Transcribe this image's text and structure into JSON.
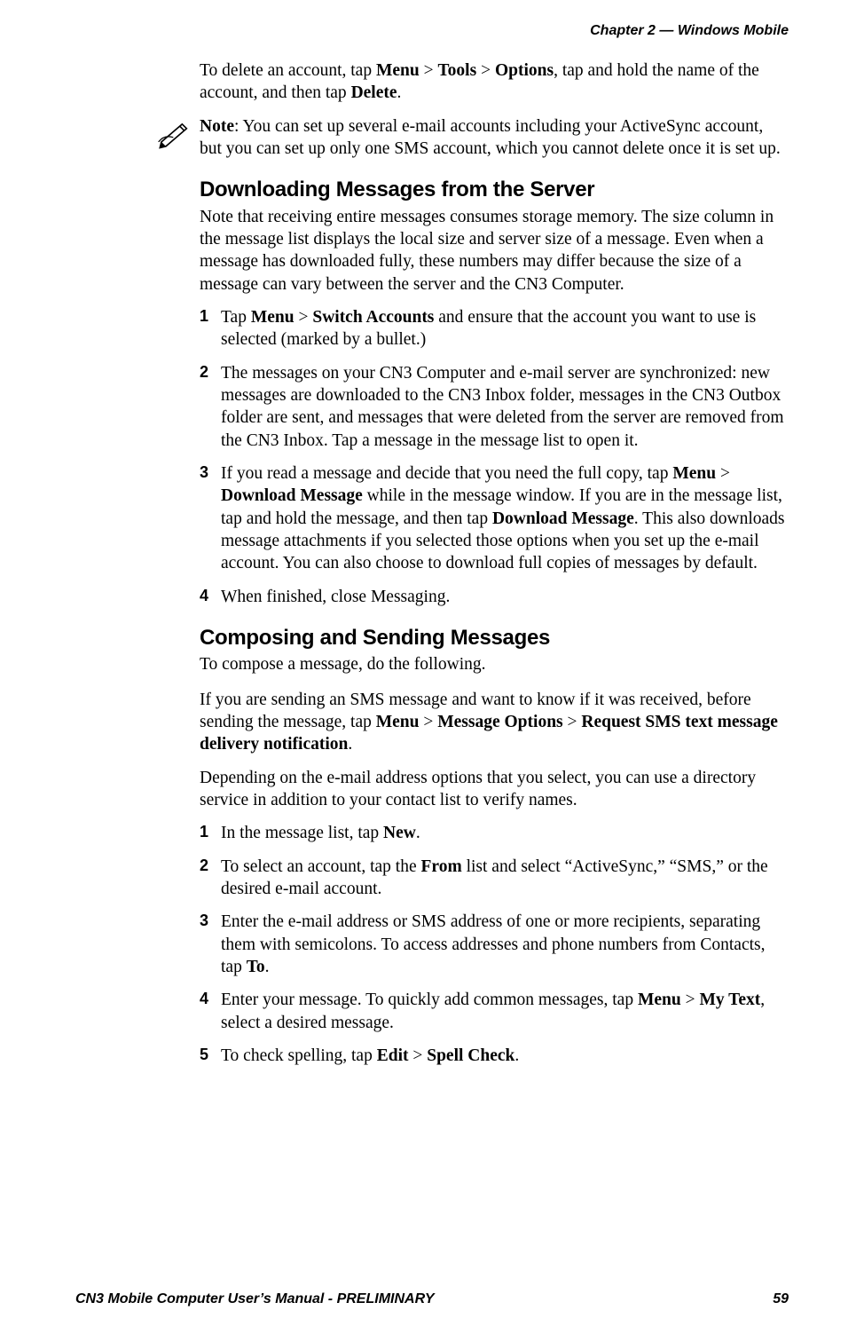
{
  "header": {
    "chapter_label": "Chapter 2 —  Windows Mobile"
  },
  "intro_para": {
    "pre": "To delete an account, tap ",
    "b1": "Menu",
    "sep1": " > ",
    "b2": "Tools",
    "sep2": " > ",
    "b3": "Options",
    "mid": ", tap and hold the name of the account, and then tap ",
    "b4": "Delete",
    "post": "."
  },
  "note": {
    "label": "Note",
    "text": ": You can set up several e-mail accounts including your ActiveSync account, but you can set up only one SMS account, which you cannot delete once it is set up."
  },
  "section1": {
    "heading": "Downloading Messages from the Server",
    "intro": "Note that receiving entire messages consumes storage memory. The size column in the message list displays the local size and server size of a message. Even when a message has downloaded fully, these numbers may differ because the size of a message can vary between the server and the CN3 Computer.",
    "step1": {
      "num": "1",
      "pre": "Tap ",
      "b1": "Menu",
      "sep1": " > ",
      "b2": "Switch Accounts",
      "post": " and ensure that the account you want to use is selected (marked by a bullet.)"
    },
    "step2": {
      "num": "2",
      "text": "The messages on your CN3 Computer and e-mail server are synchronized: new messages are downloaded to the CN3 Inbox folder, messages in the CN3 Outbox folder are sent, and messages that were deleted from the server are removed from the CN3 Inbox. Tap a message in the message list to open it."
    },
    "step3": {
      "num": "3",
      "pre": "If you read a message and decide that you need the full copy, tap ",
      "b1": "Menu",
      "sep1": " > ",
      "b2": "Download Message",
      "mid": " while in the message window. If you are in the message list, tap and hold the message, and then tap ",
      "b3": "Download Message",
      "post": ". This also downloads message attachments if you selected those options when you set up the e-mail account. You can also choose to download full copies of messages by default."
    },
    "step4": {
      "num": "4",
      "text": "When finished, close Messaging."
    }
  },
  "section2": {
    "heading": "Composing and Sending Messages",
    "intro": "To compose a message, do the following.",
    "para2": {
      "pre": "If you are sending an SMS message and want to know if it was received, before sending the message, tap ",
      "b1": "Menu",
      "sep1": " > ",
      "b2": "Message Options",
      "sep2": " > ",
      "b3": "Request SMS text message delivery notification",
      "post": "."
    },
    "para3": "Depending on the e-mail address options that you select, you can use a directory service in addition to your contact list to verify names.",
    "step1": {
      "num": "1",
      "pre": "In the message list, tap ",
      "b1": "New",
      "post": "."
    },
    "step2": {
      "num": "2",
      "pre": "To select an account, tap the ",
      "b1": "From",
      "post": " list and select “ActiveSync,” “SMS,” or the desired e-mail account."
    },
    "step3": {
      "num": "3",
      "pre": "Enter the e-mail address or SMS address of one or more recipients, separating them with semicolons. To access addresses and phone numbers from Contacts, tap ",
      "b1": "To",
      "post": "."
    },
    "step4": {
      "num": "4",
      "pre": "Enter your message. To quickly add common messages, tap ",
      "b1": "Menu",
      "sep1": " > ",
      "b2": "My Text",
      "post": ", select a desired message."
    },
    "step5": {
      "num": "5",
      "pre": "To check spelling, tap ",
      "b1": "Edit",
      "sep1": " > ",
      "b2": "Spell Check",
      "post": "."
    }
  },
  "footer": {
    "left": "CN3 Mobile Computer User’s Manual - PRELIMINARY",
    "right": "59"
  }
}
